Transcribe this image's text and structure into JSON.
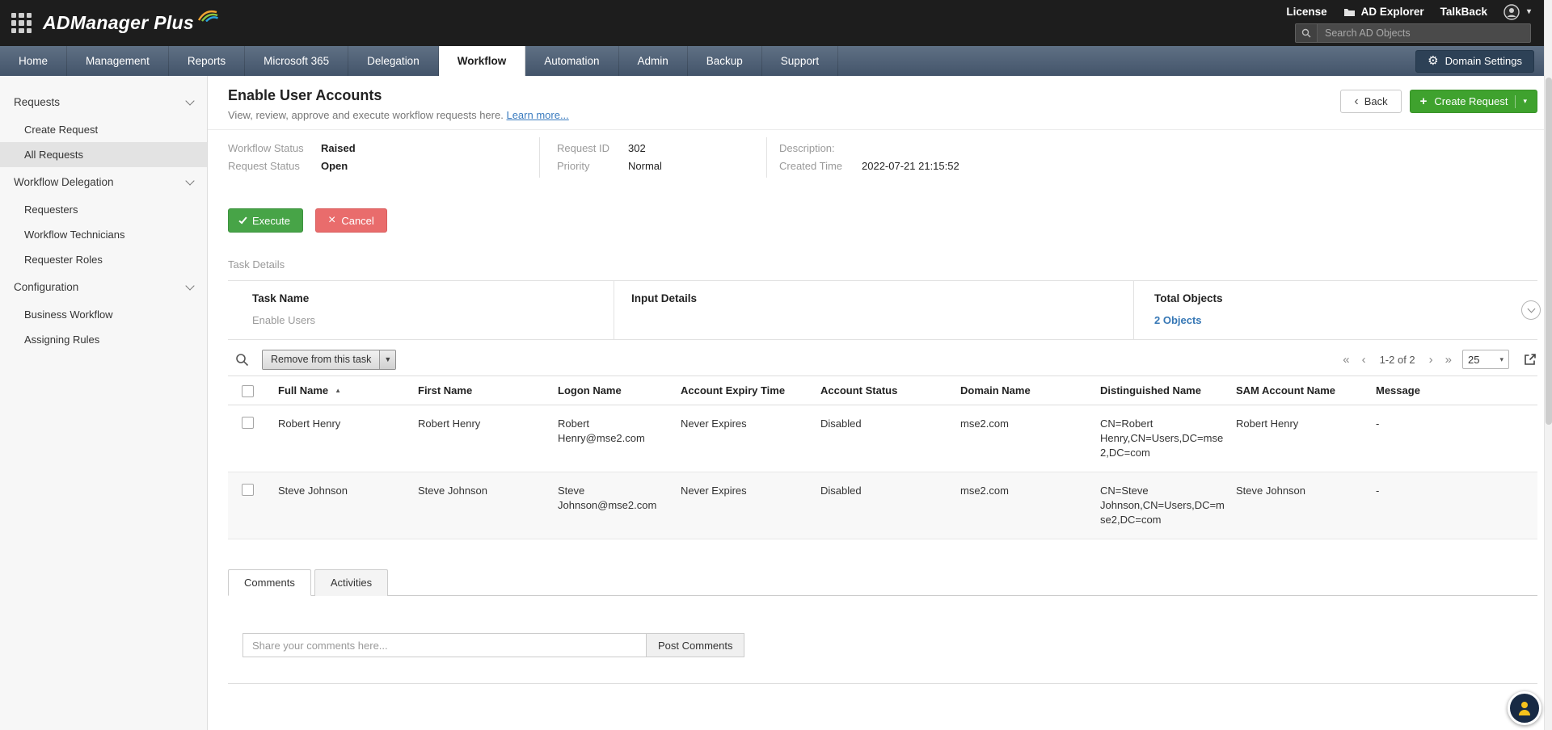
{
  "topbar": {
    "brand": "ADManager Plus",
    "links": [
      "License",
      "AD Explorer",
      "TalkBack"
    ],
    "search_placeholder": "Search AD Objects"
  },
  "nav": {
    "tabs": [
      "Home",
      "Management",
      "Reports",
      "Microsoft 365",
      "Delegation",
      "Workflow",
      "Automation",
      "Admin",
      "Backup",
      "Support"
    ],
    "active_tab": "Workflow",
    "domain_settings_label": "Domain Settings"
  },
  "sidebar": {
    "selected": "All Requests",
    "sections": [
      {
        "label": "Requests",
        "items": [
          "Create Request",
          "All Requests"
        ]
      },
      {
        "label": "Workflow Delegation",
        "items": [
          "Requesters",
          "Workflow Technicians",
          "Requester Roles"
        ]
      },
      {
        "label": "Configuration",
        "items": [
          "Business Workflow",
          "Assigning Rules"
        ]
      }
    ]
  },
  "page": {
    "title": "Enable User Accounts",
    "subtitle": "View, review, approve and execute workflow requests here.",
    "learn_more": "Learn more...",
    "back_label": "Back",
    "create_request_label": "Create Request"
  },
  "request_info": {
    "workflow_status_label": "Workflow Status",
    "workflow_status": "Raised",
    "request_status_label": "Request Status",
    "request_status": "Open",
    "request_id_label": "Request ID",
    "request_id": "302",
    "priority_label": "Priority",
    "priority": "Normal",
    "description_label": "Description:",
    "description": "",
    "created_time_label": "Created Time",
    "created_time": "2022-07-21 21:15:52"
  },
  "actions": {
    "execute_label": "Execute",
    "cancel_label": "Cancel"
  },
  "task_details": {
    "section_label": "Task Details",
    "columns": [
      "Task Name",
      "Input Details",
      "Total Objects"
    ],
    "task_name": "Enable Users",
    "input_details": "",
    "total_objects_link": "2 Objects"
  },
  "toolbar": {
    "remove_from_task_label": "Remove from this task",
    "pagination_text": "1-2 of 2",
    "page_size": "25"
  },
  "table": {
    "sort_column": "Full Name",
    "sort_direction": "asc",
    "columns": [
      "Full Name",
      "First Name",
      "Logon Name",
      "Account Expiry Time",
      "Account Status",
      "Domain Name",
      "Distinguished Name",
      "SAM Account Name",
      "Message"
    ],
    "rows": [
      [
        "Robert Henry",
        "Robert Henry",
        "Robert Henry@mse2.com",
        "Never Expires",
        "Disabled",
        "mse2.com",
        "CN=Robert Henry,CN=Users,DC=mse2,DC=com",
        "Robert Henry",
        "-"
      ],
      [
        "Steve Johnson",
        "Steve Johnson",
        "Steve Johnson@mse2.com",
        "Never Expires",
        "Disabled",
        "mse2.com",
        "CN=Steve Johnson,CN=Users,DC=mse2,DC=com",
        "Steve Johnson",
        "-"
      ]
    ]
  },
  "comments": {
    "tabs": [
      "Comments",
      "Activities"
    ],
    "active_tab": "Comments",
    "input_placeholder": "Share your comments here...",
    "post_button_label": "Post Comments"
  }
}
